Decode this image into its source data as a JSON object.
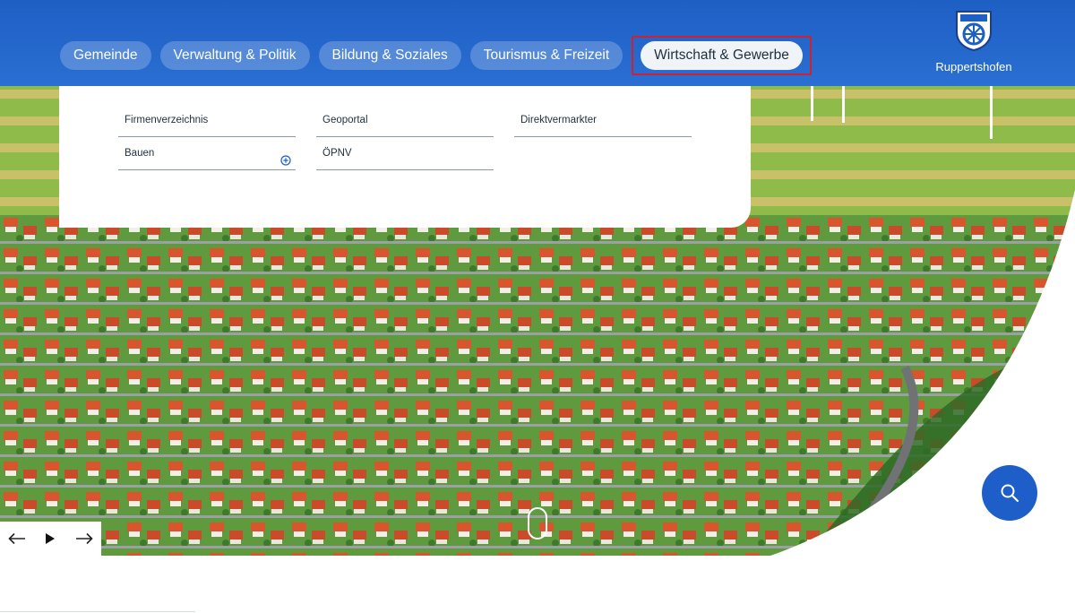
{
  "nav": {
    "tabs": [
      {
        "label": "Gemeinde"
      },
      {
        "label": "Verwaltung & Politik"
      },
      {
        "label": "Bildung & Soziales"
      },
      {
        "label": "Tourismus & Freizeit"
      },
      {
        "label": "Wirtschaft & Gewerbe",
        "active": true
      }
    ]
  },
  "logo": {
    "name": "Ruppertshofen"
  },
  "dropdown": {
    "columns": [
      [
        {
          "label": "Firmenverzeichnis"
        },
        {
          "label": "Bauen",
          "expandable": true
        }
      ],
      [
        {
          "label": "Geoportal"
        },
        {
          "label": "ÖPNV"
        }
      ],
      [
        {
          "label": "Direktvermarkter"
        }
      ]
    ]
  },
  "icons": {
    "search": "search-icon",
    "prev": "arrow-left-icon",
    "play": "play-icon",
    "next": "arrow-right-icon",
    "expand": "plus-circle-icon"
  },
  "colors": {
    "brand_blue": "#1e5fc4",
    "highlight_red": "#d2202e"
  }
}
